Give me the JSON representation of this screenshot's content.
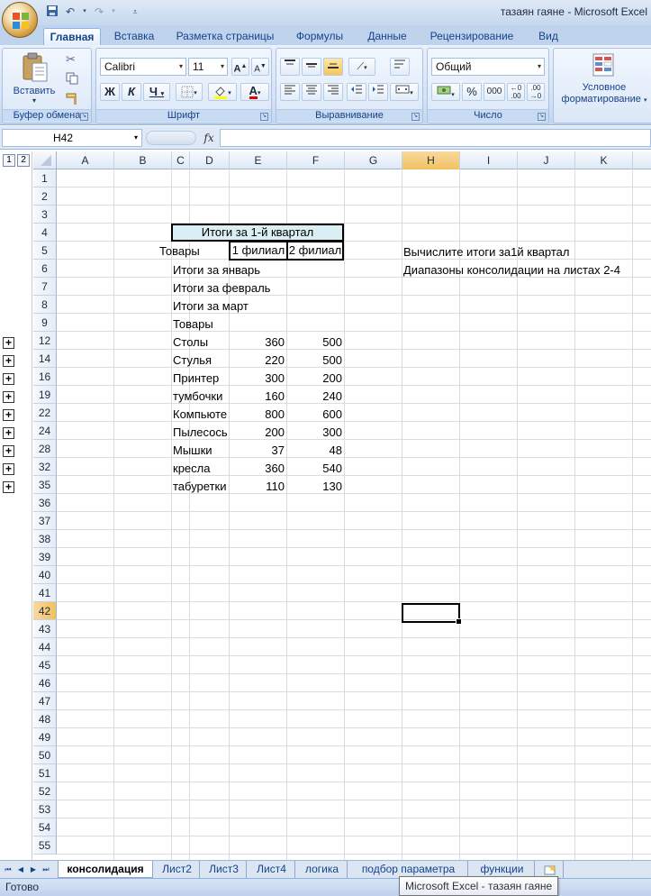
{
  "window": {
    "title": "тазаян гаяне - Microsoft Excel"
  },
  "ribbon": {
    "tabs": [
      "Главная",
      "Вставка",
      "Разметка страницы",
      "Формулы",
      "Данные",
      "Рецензирование",
      "Вид"
    ],
    "active_tab": "Главная",
    "clipboard": {
      "paste_label": "Вставить",
      "group_label": "Буфер обмена"
    },
    "font": {
      "name": "Calibri",
      "size": "11",
      "bold": "Ж",
      "italic": "К",
      "underline": "Ч",
      "group_label": "Шрифт",
      "grow": "A",
      "shrink": "A",
      "color_letter": "A"
    },
    "alignment": {
      "group_label": "Выравнивание"
    },
    "number": {
      "format": "Общий",
      "percent": "%",
      "thousands": "000",
      "group_label": "Число"
    },
    "styles": {
      "cond_format_line1": "Условное",
      "cond_format_line2": "форматирование"
    }
  },
  "formula_bar": {
    "name_box": "H42",
    "fx": "fx",
    "content": ""
  },
  "outline": {
    "levels": [
      "1",
      "2"
    ]
  },
  "grid": {
    "columns": [
      "A",
      "B",
      "C",
      "D",
      "E",
      "F",
      "G",
      "H",
      "I",
      "J",
      "K"
    ],
    "selected_column": "H",
    "rows": [
      "1",
      "2",
      "3",
      "4",
      "5",
      "6",
      "7",
      "8",
      "9",
      "12",
      "14",
      "16",
      "19",
      "22",
      "24",
      "28",
      "32",
      "35",
      "36",
      "37",
      "38",
      "39",
      "40",
      "41",
      "42",
      "43",
      "44",
      "45",
      "46",
      "47",
      "48",
      "49",
      "50",
      "51",
      "52",
      "53",
      "54",
      "55"
    ],
    "selected_row": "42",
    "header_title": "Итоги за 1-й квартал",
    "sub_headers": {
      "products": "Товары",
      "branch1": "1 филиал",
      "branch2": "2 филиал"
    },
    "labels": [
      "Итоги за январь",
      "Итоги за февраль",
      "Итоги за март",
      "Товары"
    ],
    "items": [
      {
        "name": "Столы",
        "b1": "360",
        "b2": "500"
      },
      {
        "name": "Стулья",
        "b1": "220",
        "b2": "500"
      },
      {
        "name": "Принтер",
        "b1": "300",
        "b2": "200"
      },
      {
        "name": "тумбочки",
        "b1": "160",
        "b2": "240"
      },
      {
        "name": "Компьюте",
        "b1": "800",
        "b2": "600"
      },
      {
        "name": "Пылесось",
        "b1": "200",
        "b2": "300"
      },
      {
        "name": "Мышки",
        "b1": "37",
        "b2": "48"
      },
      {
        "name": "кресла",
        "b1": "360",
        "b2": "540"
      },
      {
        "name": "табуретки",
        "b1": "110",
        "b2": "130"
      }
    ],
    "notes": [
      "Вычислите итоги за1й квартал",
      "Диапазоны консолидации на листах 2-4"
    ]
  },
  "sheets": {
    "tabs": [
      "консолидация",
      "Лист2",
      "Лист3",
      "Лист4",
      "логика",
      "подбор параметра",
      "функции"
    ],
    "active": "консолидация"
  },
  "status": {
    "text": "Готово",
    "tooltip": "Microsoft Excel - тазаян гаяне"
  }
}
